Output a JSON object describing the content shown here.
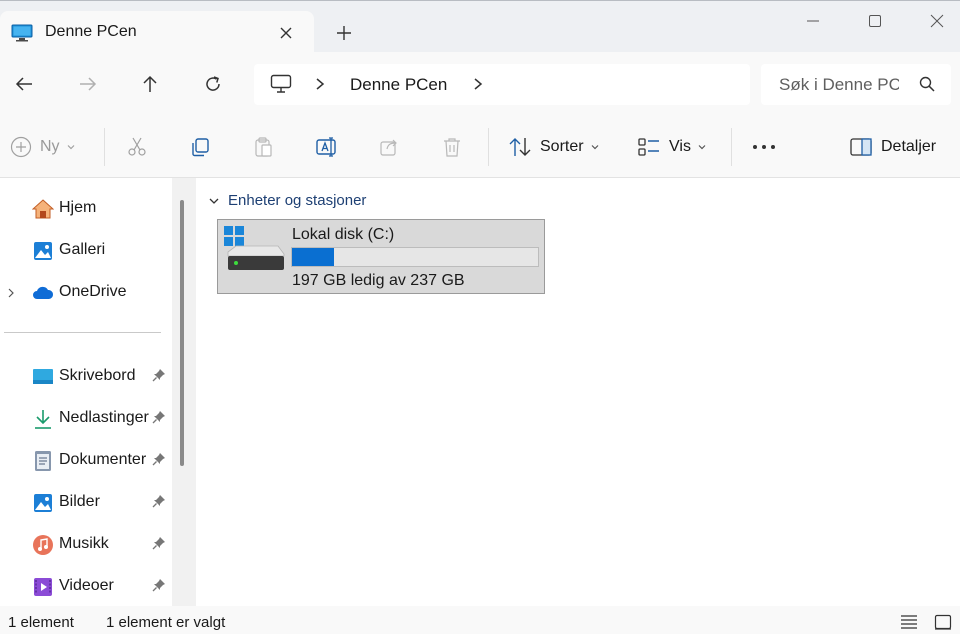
{
  "tab": {
    "title": "Denne PCen",
    "icon": "monitor-icon"
  },
  "window": {
    "minimize": "minimize-icon",
    "maximize": "maximize-icon",
    "close": "close-icon"
  },
  "address": {
    "path": "Denne PCen"
  },
  "search": {
    "placeholder": "Søk i Denne PCen"
  },
  "toolbar": {
    "new_label": "Ny",
    "sort_label": "Sorter",
    "view_label": "Vis",
    "details_label": "Detaljer"
  },
  "sidebar": {
    "top_items": [
      {
        "label": "Hjem",
        "icon": "home-icon"
      },
      {
        "label": "Galleri",
        "icon": "gallery-icon"
      },
      {
        "label": "OneDrive",
        "icon": "cloud-icon"
      }
    ],
    "pinned_items": [
      {
        "label": "Skrivebord",
        "icon": "desktop-icon"
      },
      {
        "label": "Nedlastinger",
        "icon": "download-icon"
      },
      {
        "label": "Dokumenter",
        "icon": "document-icon"
      },
      {
        "label": "Bilder",
        "icon": "pictures-icon"
      },
      {
        "label": "Musikk",
        "icon": "music-icon"
      },
      {
        "label": "Videoer",
        "icon": "video-icon"
      }
    ]
  },
  "main": {
    "group_label": "Enheter og stasjoner",
    "drive": {
      "name": "Lokal disk (C:)",
      "free_text": "197 GB ledig av 237 GB",
      "used_fraction": 0.169,
      "bar_color": "#0a6fd1"
    }
  },
  "status": {
    "count": "1 element",
    "selected": "1 element er valgt"
  },
  "colors": {
    "accent": "#0a6fd1",
    "group_header": "#1d3f73"
  }
}
